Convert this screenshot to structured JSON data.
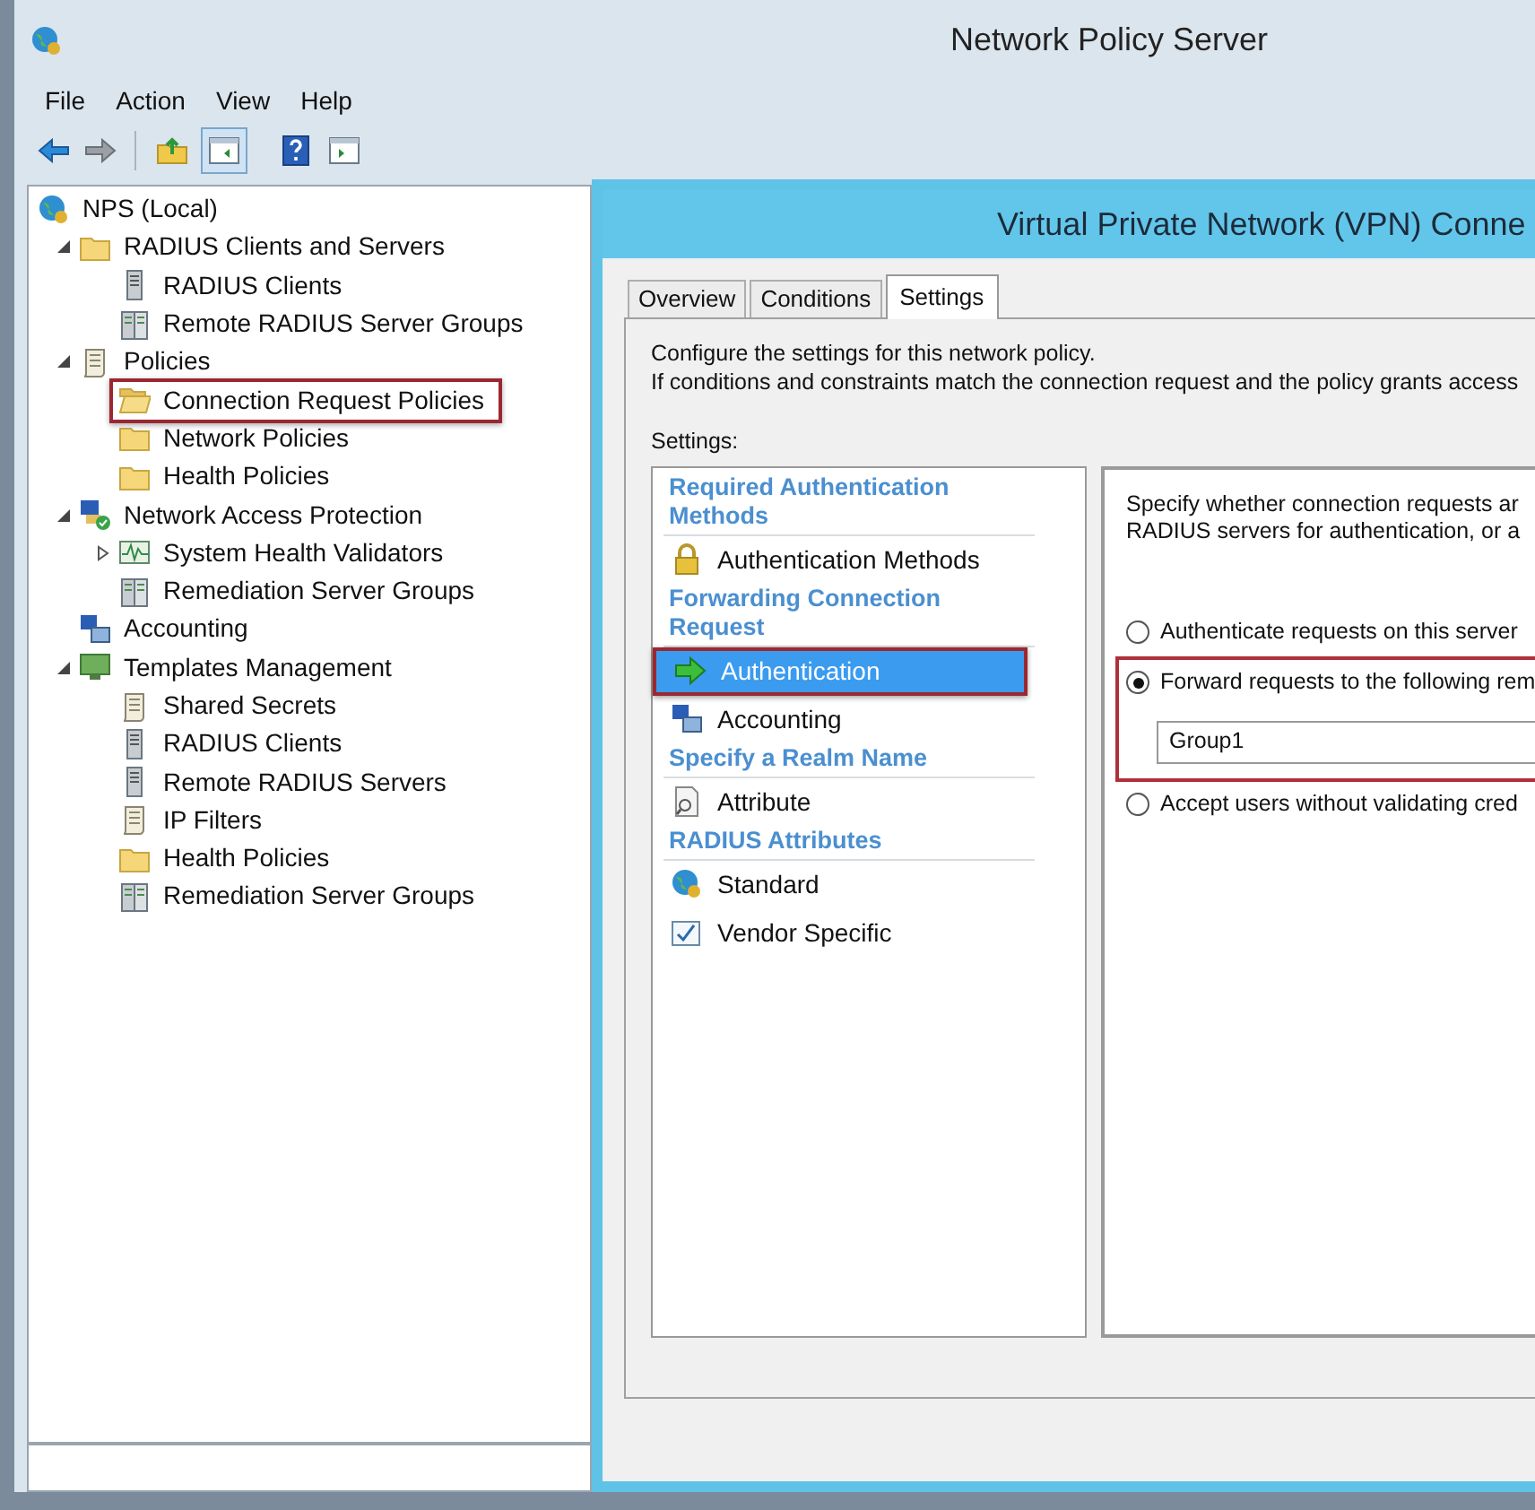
{
  "window": {
    "title": "Network Policy Server"
  },
  "menu": [
    "File",
    "Action",
    "View",
    "Help"
  ],
  "tree": [
    {
      "label": "NPS (Local)",
      "kind": "globe",
      "highlighted": false,
      "children": [
        {
          "label": "RADIUS Clients and Servers",
          "kind": "folder",
          "expanded": true,
          "highlighted": false,
          "children": [
            {
              "label": "RADIUS Clients",
              "kind": "server",
              "highlighted": false
            },
            {
              "label": "Remote RADIUS Server Groups",
              "kind": "server-group",
              "highlighted": false
            }
          ]
        },
        {
          "label": "Policies",
          "kind": "scroll",
          "expanded": true,
          "highlighted": false,
          "children": [
            {
              "label": "Connection Request Policies",
              "kind": "folder-open",
              "highlighted": true
            },
            {
              "label": "Network Policies",
              "kind": "folder",
              "highlighted": false
            },
            {
              "label": "Health Policies",
              "kind": "folder",
              "highlighted": false
            }
          ]
        },
        {
          "label": "Network Access Protection",
          "kind": "network",
          "expanded": true,
          "highlighted": false,
          "children": [
            {
              "label": "System Health Validators",
              "kind": "chart",
              "expanded": false,
              "highlighted": false
            },
            {
              "label": "Remediation Server Groups",
              "kind": "server-group",
              "highlighted": false
            }
          ]
        },
        {
          "label": "Accounting",
          "kind": "computers",
          "highlighted": false
        },
        {
          "label": "Templates Management",
          "kind": "monitor",
          "expanded": true,
          "highlighted": false,
          "children": [
            {
              "label": "Shared Secrets",
              "kind": "scroll",
              "highlighted": false
            },
            {
              "label": "RADIUS Clients",
              "kind": "server",
              "highlighted": false
            },
            {
              "label": "Remote RADIUS Servers",
              "kind": "server",
              "highlighted": false
            },
            {
              "label": "IP Filters",
              "kind": "scroll",
              "highlighted": false
            },
            {
              "label": "Health Policies",
              "kind": "folder",
              "highlighted": false
            },
            {
              "label": "Remediation Server Groups",
              "kind": "server-group",
              "highlighted": false
            }
          ]
        }
      ]
    }
  ],
  "dialog": {
    "title": "Virtual Private Network (VPN) Conne",
    "tabs": [
      {
        "label": "Overview",
        "selected": false
      },
      {
        "label": "Conditions",
        "selected": false
      },
      {
        "label": "Settings",
        "selected": true
      }
    ],
    "description": [
      "Configure the settings for this network policy.",
      "If conditions and constraints match the connection request and the policy grants access"
    ],
    "settings_label": "Settings:",
    "settings_list": [
      {
        "heading": "Required Authentication Methods",
        "items": [
          {
            "label": "Authentication Methods",
            "kind": "lock",
            "selected": false,
            "highlighted": false
          }
        ]
      },
      {
        "heading": "Forwarding Connection Request",
        "items": [
          {
            "label": "Authentication",
            "kind": "arrow",
            "selected": true,
            "highlighted": true
          },
          {
            "label": "Accounting",
            "kind": "computers",
            "selected": false,
            "highlighted": false
          }
        ]
      },
      {
        "heading": "Specify a Realm Name",
        "items": [
          {
            "label": "Attribute",
            "kind": "magnifier",
            "selected": false,
            "highlighted": false
          }
        ]
      },
      {
        "heading": "RADIUS Attributes",
        "items": [
          {
            "label": "Standard",
            "kind": "globe",
            "selected": false,
            "highlighted": false
          },
          {
            "label": "Vendor Specific",
            "kind": "check-page",
            "selected": false,
            "highlighted": false
          }
        ]
      }
    ],
    "detail": {
      "description": [
        "Specify whether connection requests ar",
        "RADIUS servers for authentication, or a"
      ],
      "options": [
        {
          "label": "Authenticate requests on this server",
          "selected": false,
          "highlighted": false
        },
        {
          "label": "Forward requests to the following rem",
          "selected": true,
          "highlighted": true,
          "field": {
            "value": "Group1"
          }
        },
        {
          "label": "Accept users without validating cred",
          "selected": false,
          "highlighted": false
        }
      ]
    }
  }
}
